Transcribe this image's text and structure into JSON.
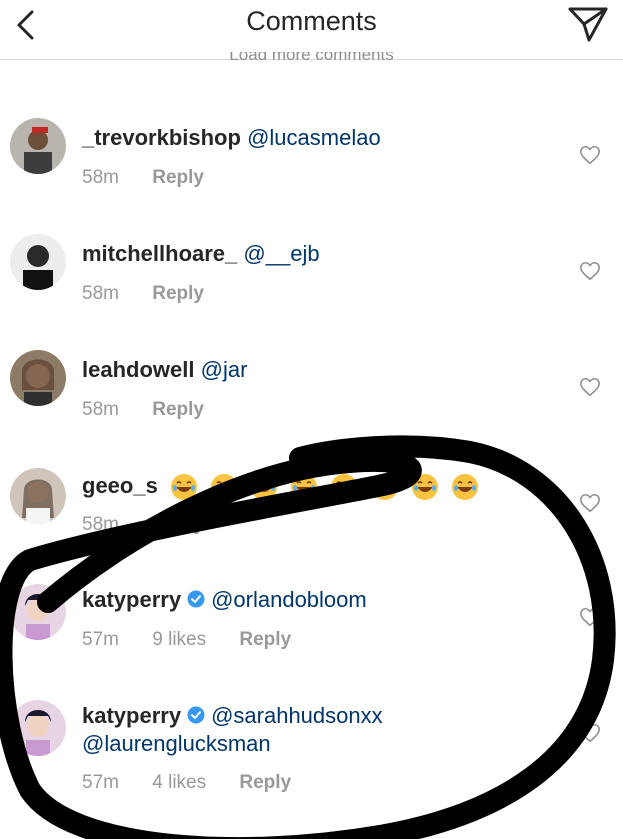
{
  "header": {
    "title": "Comments",
    "back_icon": "chevron-left-icon",
    "share_icon": "paper-plane-icon"
  },
  "load_more": "Load more comments",
  "comments": [
    {
      "username": "_trevorkbishop",
      "mention": "@lucasmelao",
      "time": "58m",
      "likes": "",
      "reply": "Reply"
    },
    {
      "username": "mitchellhoare_",
      "mention": "@__ejb",
      "time": "58m",
      "likes": "",
      "reply": "Reply"
    },
    {
      "username": "leahdowell",
      "mention": "@jar",
      "time": "58m",
      "likes": "",
      "reply": "Reply"
    },
    {
      "username": "geeo_s",
      "mention": "",
      "emoji_count": 8,
      "time": "58m",
      "likes": "",
      "reply": "Reply"
    },
    {
      "username": "katyperry",
      "verified": true,
      "mention": "@orlandobloom",
      "time": "57m",
      "likes": "9 likes",
      "reply": "Reply"
    },
    {
      "username": "katyperry",
      "verified": true,
      "mention": "@sarahhudsonxx",
      "mention2": "@laurenglucksman",
      "time": "57m",
      "likes": "4 likes",
      "reply": "Reply"
    }
  ],
  "colors": {
    "text": "#262626",
    "mention": "#003569",
    "meta": "#999999",
    "verified": "#3897f0",
    "marker": "#000000"
  }
}
